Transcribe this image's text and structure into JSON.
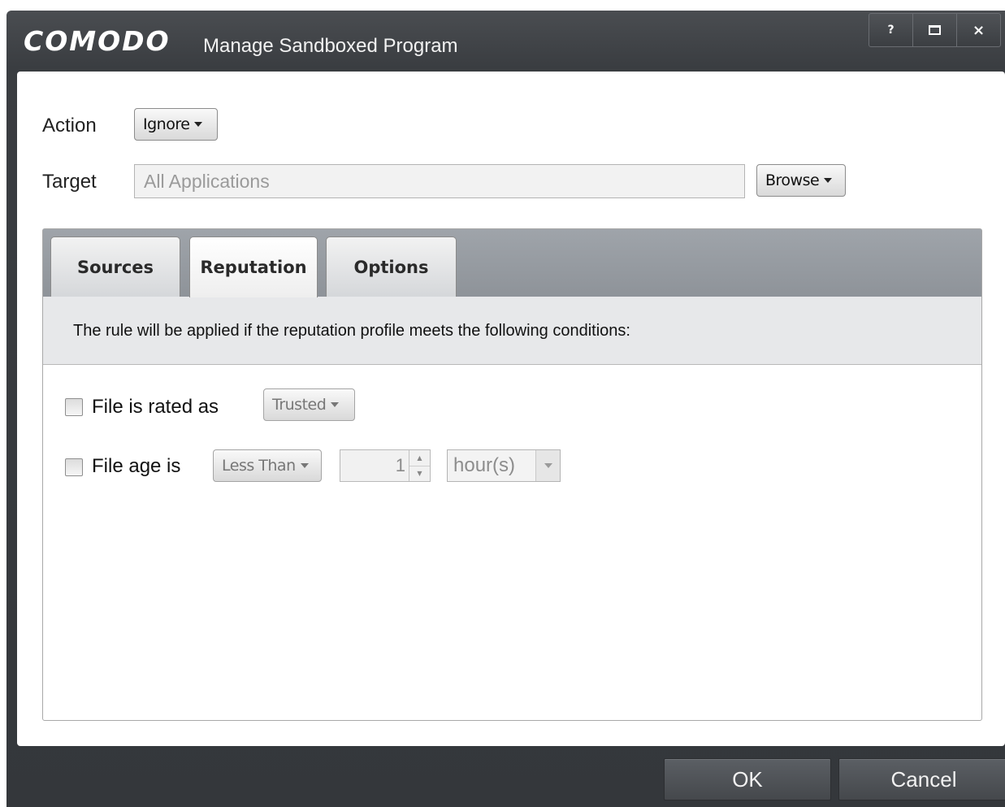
{
  "window": {
    "brand": "COMODO",
    "title": "Manage Sandboxed Program",
    "controls": {
      "help": "?",
      "close": "×"
    }
  },
  "form": {
    "action_label": "Action",
    "action_value": "Ignore",
    "target_label": "Target",
    "target_placeholder": "All Applications",
    "browse_label": "Browse"
  },
  "tabs": [
    {
      "label": "Sources",
      "active": false
    },
    {
      "label": "Reputation",
      "active": true
    },
    {
      "label": "Options",
      "active": false
    }
  ],
  "reputation": {
    "description": "The rule will be applied if the reputation profile meets the following conditions:",
    "rated_label": "File is rated as",
    "rated_checked": false,
    "rated_value": "Trusted",
    "age_label": "File age is",
    "age_checked": false,
    "age_comparator": "Less Than",
    "age_amount": "1",
    "age_unit": "hour(s)"
  },
  "footer": {
    "ok_label": "OK",
    "cancel_label": "Cancel"
  }
}
